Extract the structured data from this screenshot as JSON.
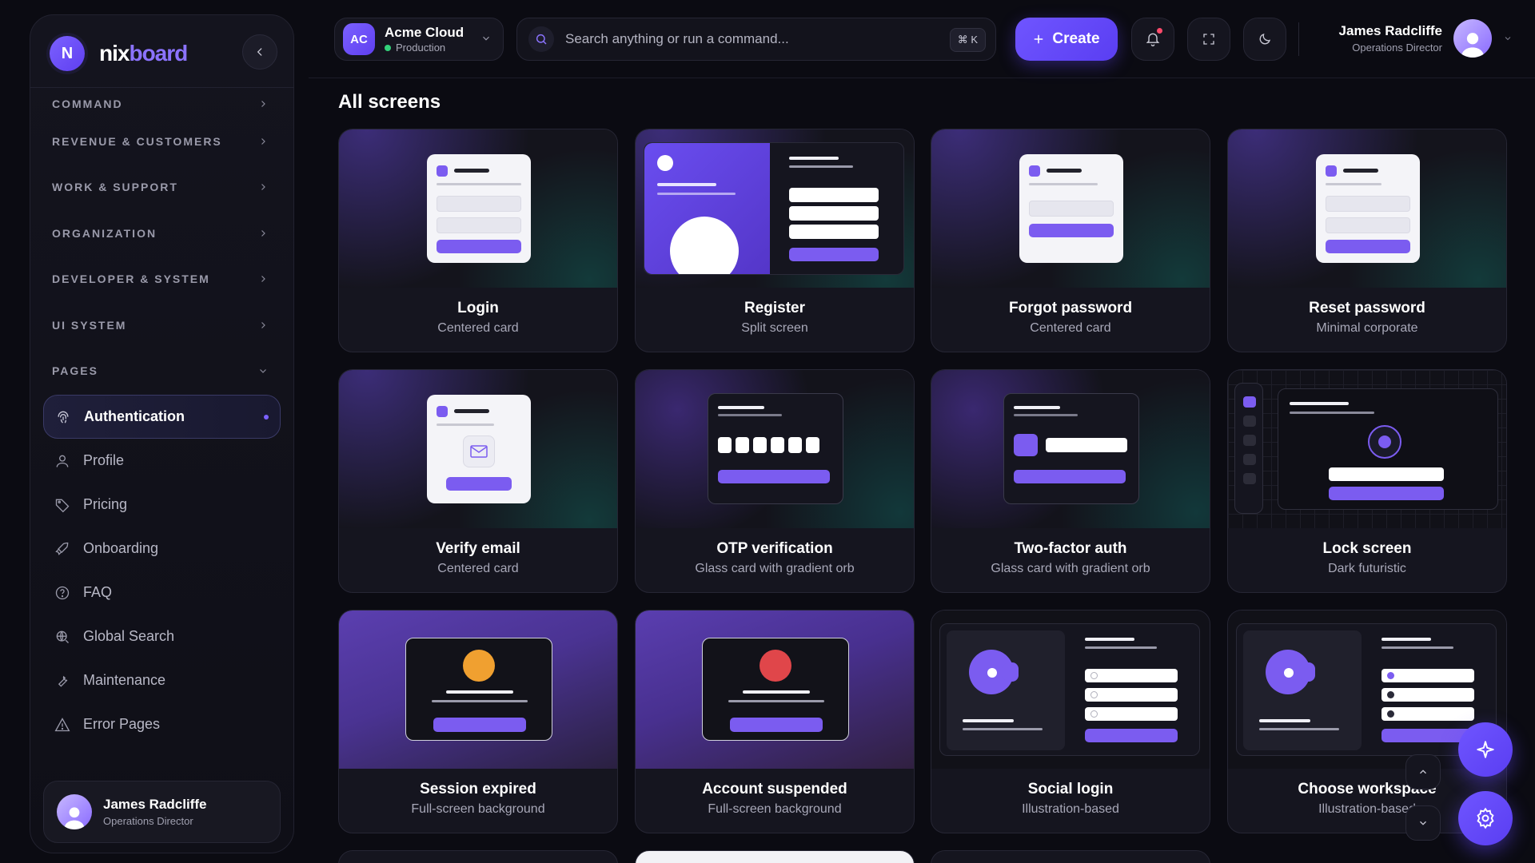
{
  "brand": {
    "badge": "N",
    "name_a": "nix",
    "name_b": "board"
  },
  "sidebar": {
    "sections": [
      {
        "label": "COMMAND"
      },
      {
        "label": "REVENUE & CUSTOMERS"
      },
      {
        "label": "WORK & SUPPORT"
      },
      {
        "label": "ORGANIZATION"
      },
      {
        "label": "DEVELOPER & SYSTEM"
      },
      {
        "label": "UI SYSTEM"
      },
      {
        "label": "PAGES"
      }
    ],
    "pages": [
      {
        "label": "Authentication",
        "icon": "fingerprint-icon",
        "active": true
      },
      {
        "label": "Profile",
        "icon": "user-icon"
      },
      {
        "label": "Pricing",
        "icon": "tag-icon"
      },
      {
        "label": "Onboarding",
        "icon": "rocket-icon"
      },
      {
        "label": "FAQ",
        "icon": "help-circle-icon"
      },
      {
        "label": "Global Search",
        "icon": "globe-search-icon"
      },
      {
        "label": "Maintenance",
        "icon": "wrench-icon"
      },
      {
        "label": "Error Pages",
        "icon": "warning-icon"
      }
    ],
    "user": {
      "name": "James Radcliffe",
      "role": "Operations Director"
    }
  },
  "topbar": {
    "workspace": {
      "badge": "AC",
      "name": "Acme Cloud",
      "env": "Production"
    },
    "search": {
      "placeholder": "Search anything or run a command...",
      "shortcut": "⌘ K"
    },
    "create_label": "Create",
    "user": {
      "name": "James Radcliffe",
      "role": "Operations Director"
    }
  },
  "main": {
    "title": "All screens",
    "cards": [
      {
        "title": "Login",
        "subtitle": "Centered card"
      },
      {
        "title": "Register",
        "subtitle": "Split screen"
      },
      {
        "title": "Forgot password",
        "subtitle": "Centered card"
      },
      {
        "title": "Reset password",
        "subtitle": "Minimal corporate"
      },
      {
        "title": "Verify email",
        "subtitle": "Centered card"
      },
      {
        "title": "OTP verification",
        "subtitle": "Glass card with gradient orb"
      },
      {
        "title": "Two-factor auth",
        "subtitle": "Glass card with gradient orb"
      },
      {
        "title": "Lock screen",
        "subtitle": "Dark futuristic"
      },
      {
        "title": "Session expired",
        "subtitle": "Full-screen background"
      },
      {
        "title": "Account suspended",
        "subtitle": "Full-screen background"
      },
      {
        "title": "Social login",
        "subtitle": "Illustration-based"
      },
      {
        "title": "Choose workspace",
        "subtitle": "Illustration-based"
      }
    ]
  },
  "colors": {
    "accent": "#7b5cf0",
    "background": "#0b0b12",
    "online": "#33d17a",
    "warning_orb": "#f0a030",
    "danger_orb": "#e0464a"
  }
}
